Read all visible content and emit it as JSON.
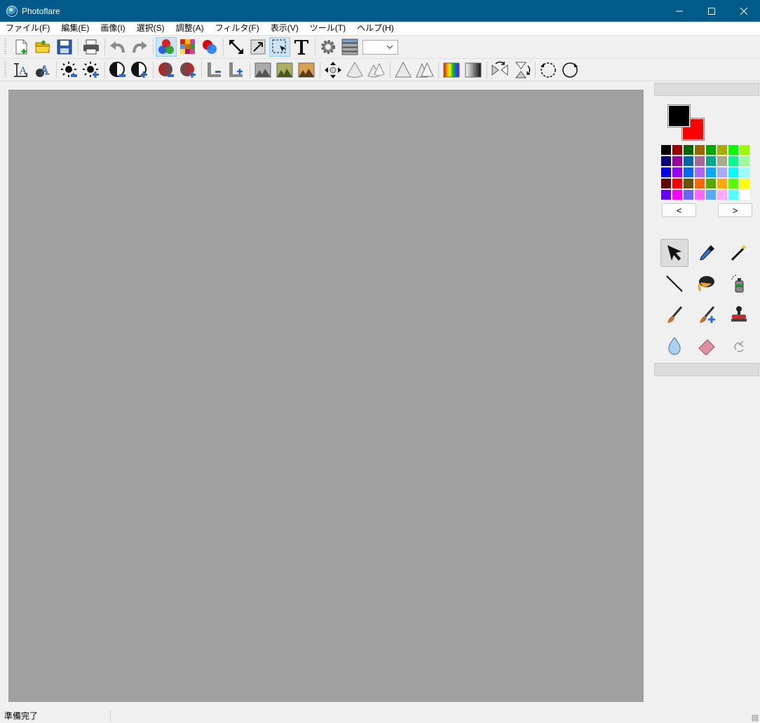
{
  "window": {
    "title": "Photoflare",
    "minimize_label": "—",
    "maximize_label": "☐",
    "close_label": "✕"
  },
  "menu": {
    "items": [
      {
        "label": "ファイル(F)"
      },
      {
        "label": "編集(E)"
      },
      {
        "label": "画像(I)"
      },
      {
        "label": "選択(S)"
      },
      {
        "label": "調整(A)"
      },
      {
        "label": "フィルタ(F)"
      },
      {
        "label": "表示(V)"
      },
      {
        "label": "ツール(T)"
      },
      {
        "label": "ヘルプ(H)"
      }
    ]
  },
  "toolbar1": {
    "zoom_value": "",
    "icons": [
      "new-file-icon",
      "open-folder-icon",
      "save-icon",
      "print-icon",
      "undo-icon",
      "redo-icon",
      "color-mode-icon",
      "palette-grid-icon",
      "color-circles-icon",
      "resize-arrow-icon",
      "crop-icon",
      "select-icon",
      "text-icon",
      "settings-icon",
      "layers-icon"
    ]
  },
  "toolbar2": {
    "icons": [
      "font-serif-icon",
      "font-outline-icon",
      "brightness-down-icon",
      "brightness-up-icon",
      "contrast-down-icon",
      "contrast-up-icon",
      "saturation-down-icon",
      "saturation-up-icon",
      "gamma-down-icon",
      "gamma-up-icon",
      "landscape-gray-icon",
      "landscape-green-icon",
      "landscape-sepia-icon",
      "move-cross-icon",
      "cone-icon",
      "cones-icon",
      "triangle-icon",
      "triangles-icon",
      "gradient-rainbow-icon",
      "gradient-gray-icon",
      "flip-horizontal-icon",
      "flip-vertical-icon",
      "rotate-left-icon",
      "rotate-right-icon"
    ]
  },
  "colors": {
    "foreground": "#000000",
    "background": "#ff0000",
    "palette": [
      "#000000",
      "#990000",
      "#006600",
      "#996600",
      "#00aa00",
      "#aaaa00",
      "#00ff00",
      "#99ff00",
      "#000080",
      "#990099",
      "#0066aa",
      "#aa6699",
      "#00aa88",
      "#aaaa88",
      "#00ff88",
      "#99ff99",
      "#0000ff",
      "#9900ff",
      "#0066ff",
      "#aa66ff",
      "#00aaff",
      "#aaaaff",
      "#00ffff",
      "#99ffff",
      "#660000",
      "#ff0000",
      "#665500",
      "#ff6600",
      "#55aa00",
      "#ffaa00",
      "#55ff00",
      "#ffff00",
      "#6600ff",
      "#ff00ff",
      "#6666ff",
      "#ff66ff",
      "#55aaff",
      "#ffaaff",
      "#55ffff",
      "#ffffff"
    ],
    "prev_label": "<",
    "next_label": ">"
  },
  "tools": [
    "pointer-icon",
    "eyedropper-icon",
    "magic-wand-icon",
    "line-icon",
    "paint-bucket-icon",
    "spray-can-icon",
    "paintbrush-icon",
    "paintbrush-plus-icon",
    "stamp-icon",
    "blur-drop-icon",
    "eraser-icon",
    "smudge-icon"
  ],
  "status": {
    "text": "準備完了"
  }
}
